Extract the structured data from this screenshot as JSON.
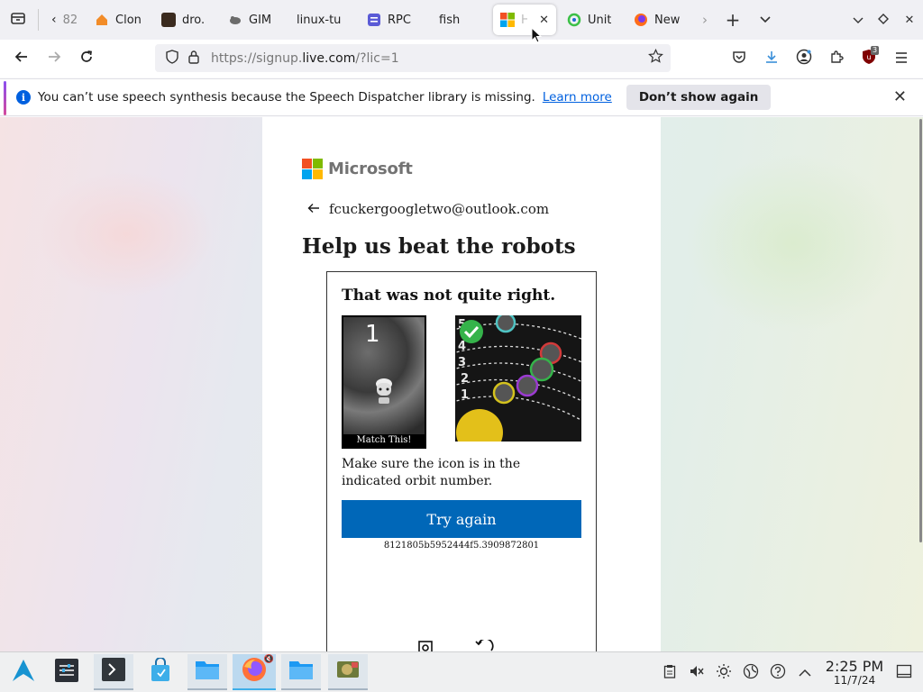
{
  "tabs": [
    {
      "label": "82",
      "favicon_color": "#9aa0a6"
    },
    {
      "label": "Clon",
      "favicon_color": "#f28c28"
    },
    {
      "label": "dro.",
      "favicon_color": "#3b2b1f"
    },
    {
      "label": "GIM",
      "favicon_color": "#6b6b6b"
    },
    {
      "label": "linux-tu",
      "favicon_color": ""
    },
    {
      "label": "RPC",
      "favicon_color": "#5b5bd6"
    },
    {
      "label": "fish",
      "favicon_color": ""
    },
    {
      "label": "H",
      "favicon_color": "ms",
      "active": true
    },
    {
      "label": "Unit",
      "favicon_color": "#3cc047"
    },
    {
      "label": "New",
      "favicon_color": "#ff6d1a"
    }
  ],
  "nav": {
    "url_prefix": "https://signup.",
    "url_domain": "live.com",
    "url_suffix": "/?lic=1",
    "extension_badge": "3"
  },
  "notification": {
    "message": "You can’t use speech synthesis because the Speech Dispatcher library is missing.",
    "learn_more": "Learn more",
    "dont_show": "Don’t show again"
  },
  "page": {
    "brand": "Microsoft",
    "email": "fcuckergoogletwo@outlook.com",
    "heading": "Help us beat the robots",
    "challenge_title": "That was not quite right.",
    "match_caption": "Match This!",
    "match_number": "1",
    "orbit_numbers": [
      "5",
      "4",
      "3",
      "2",
      "1"
    ],
    "hint": "Make sure the icon is in the indicated orbit number.",
    "try_again": "Try again",
    "session_id": "8121805b5952444f5.3909872801"
  },
  "taskbar": {
    "time": "2:25 PM",
    "date": "11/7/24"
  },
  "colors": {
    "ms_red": "#f25022",
    "ms_green": "#7fba00",
    "ms_blue": "#00a4ef",
    "ms_yellow": "#ffb900",
    "button_blue": "#0067b8"
  }
}
